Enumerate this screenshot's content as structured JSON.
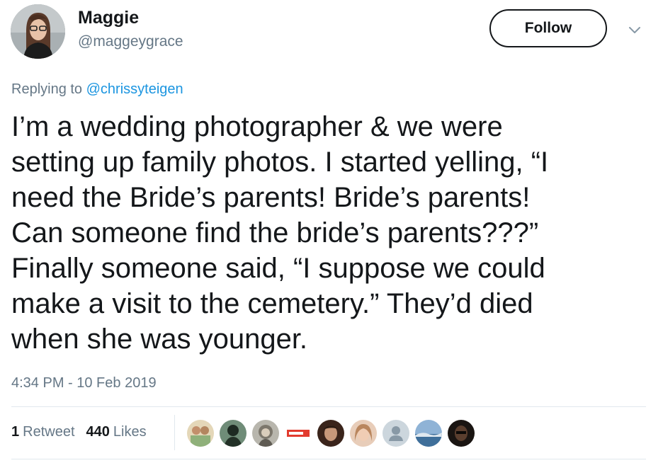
{
  "author": {
    "display_name": "Maggie",
    "handle": "@maggeygrace",
    "avatar_icon": "profile-photo-icon"
  },
  "actions": {
    "follow_label": "Follow",
    "more_icon": "chevron-down-icon"
  },
  "reply": {
    "prefix": "Replying to",
    "mention": "@chrissyteigen"
  },
  "tweet": {
    "text": "I’m a wedding photographer & we were\nsetting up family photos. I started yelling, “I\nneed the Bride’s parents! Bride’s parents!\nCan someone find the bride’s parents???”\nFinally someone said, “I suppose we could\nmake a visit to the cemetery.” They’d died\nwhen she was younger.",
    "timestamp": "4:34 PM - 10 Feb 2019"
  },
  "stats": {
    "retweets_count": "1",
    "retweets_label": "Retweet",
    "likes_count": "440",
    "likes_label": "Likes"
  },
  "likers": [
    {
      "icon": "liker-avatar-1",
      "color": "#d9c7a3"
    },
    {
      "icon": "liker-avatar-2",
      "color": "#2f4a3a"
    },
    {
      "icon": "liker-avatar-3",
      "color": "#7a7a72"
    },
    {
      "icon": "liker-logo-avatar",
      "color": "#e23b2e"
    },
    {
      "icon": "liker-avatar-5",
      "color": "#4a2c22"
    },
    {
      "icon": "liker-avatar-6",
      "color": "#c9a98f"
    },
    {
      "icon": "liker-default-avatar",
      "color": "#ccd6dd"
    },
    {
      "icon": "liker-avatar-8",
      "color": "#3f6f9a"
    },
    {
      "icon": "liker-avatar-9",
      "color": "#2a1f1a"
    }
  ],
  "colors": {
    "text_primary": "#14171a",
    "text_secondary": "#657786",
    "link": "#1b95e0",
    "divider": "#e1e8ed"
  }
}
